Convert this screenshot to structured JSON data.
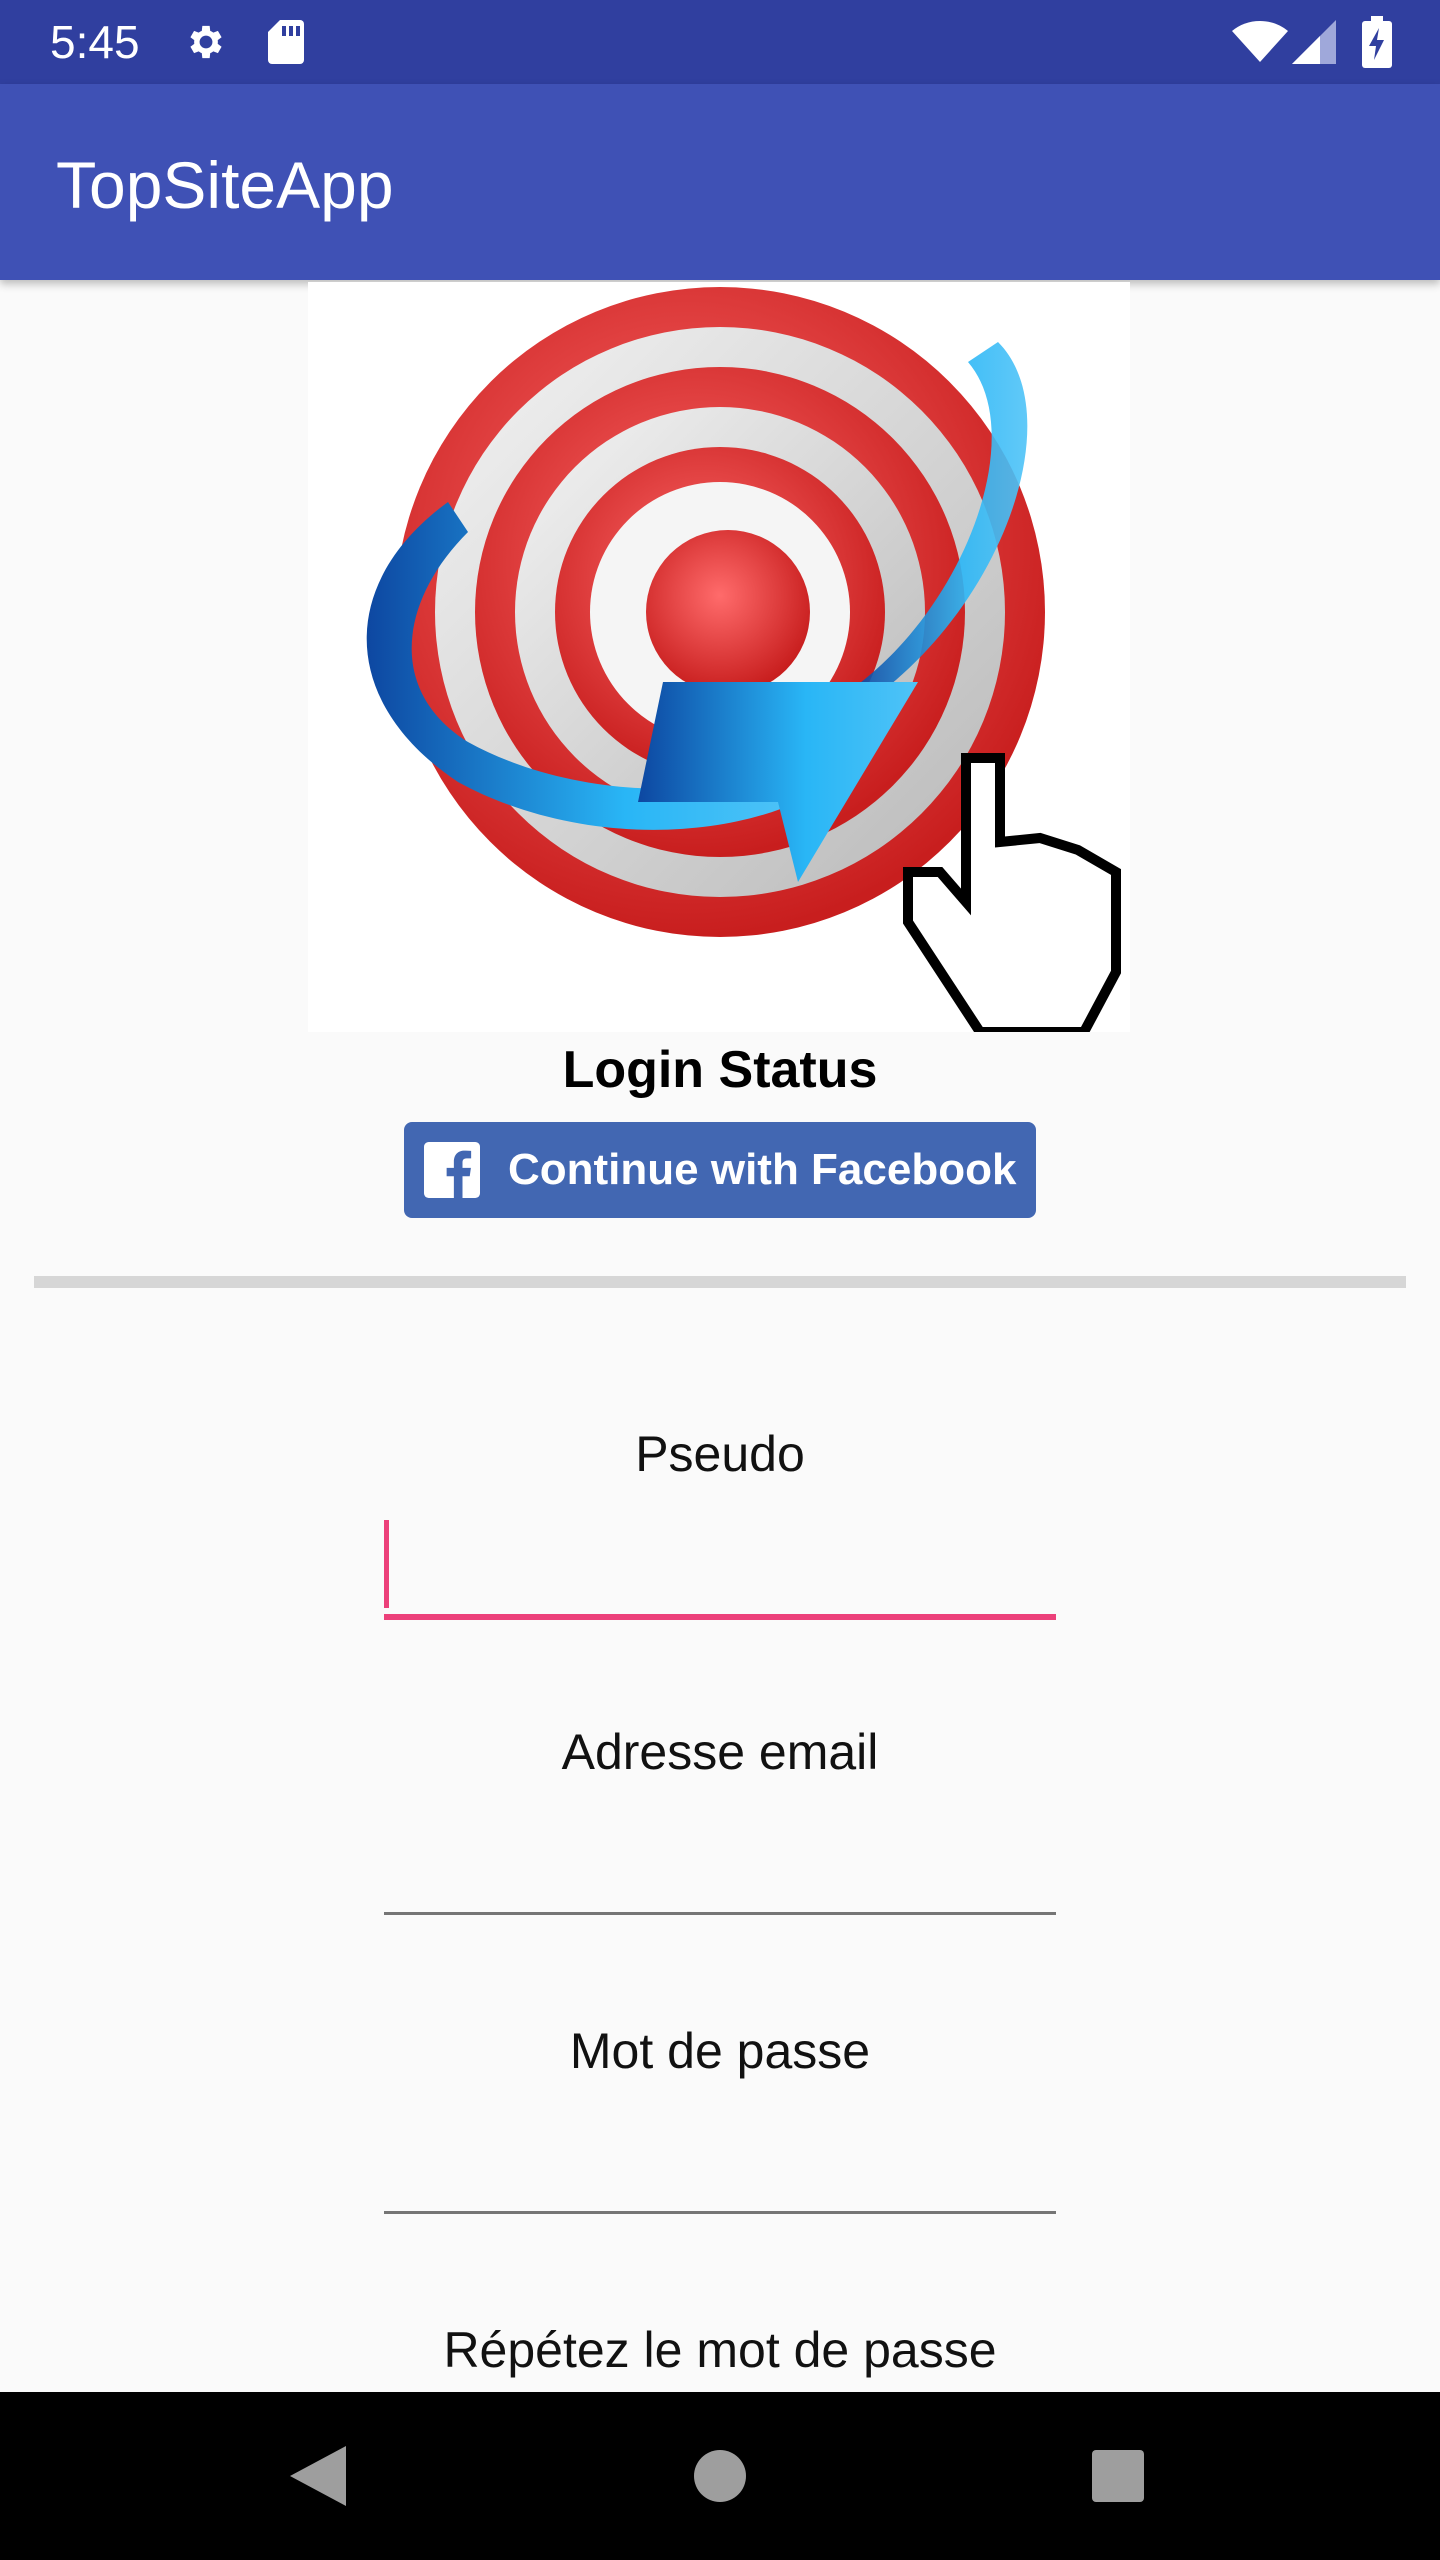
{
  "status_bar": {
    "time": "5:45",
    "icons": [
      "gear-icon",
      "sd-card-icon",
      "wifi-icon",
      "cell-signal-icon",
      "battery-charging-icon"
    ]
  },
  "app_bar": {
    "title": "TopSiteApp",
    "color": "#3f51b5"
  },
  "logo": {
    "icon": "target-arrow-hand-logo"
  },
  "login": {
    "status_label": "Login Status",
    "facebook_button_label": "Continue with Facebook",
    "facebook_color": "#4267b2"
  },
  "form": {
    "fields": [
      {
        "label": "Pseudo",
        "value": ""
      },
      {
        "label": "Adresse email",
        "value": ""
      },
      {
        "label": "Mot de passe",
        "value": ""
      },
      {
        "label": "Répétez le mot de passe",
        "value": ""
      }
    ],
    "focus_color": "#ec407a"
  },
  "nav_bar": {
    "icons": [
      "back-icon",
      "home-icon",
      "recents-icon"
    ]
  }
}
